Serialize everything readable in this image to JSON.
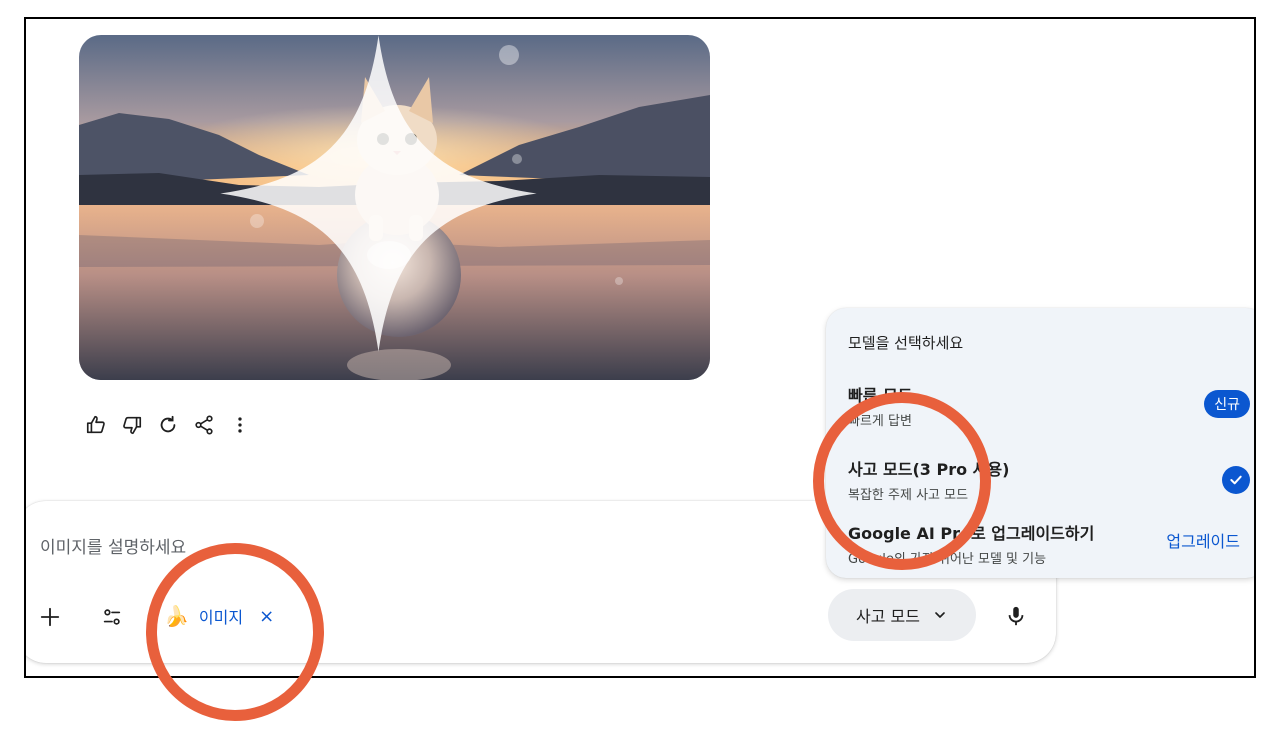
{
  "response": {
    "image_alt": "Kitten sitting on a crystal ball above a lake at sunset"
  },
  "actions": [
    {
      "name": "thumbs-up-icon"
    },
    {
      "name": "thumbs-down-icon"
    },
    {
      "name": "regenerate-icon"
    },
    {
      "name": "share-icon"
    },
    {
      "name": "more-options-icon"
    }
  ],
  "composer": {
    "placeholder": "이미지를 설명하세요",
    "chip_label": "이미지",
    "chip_close": "×",
    "mode_label": "사고 모드"
  },
  "model_menu": {
    "title": "모델을 선택하세요",
    "options": [
      {
        "name": "빠른 모드",
        "desc": "빠르게 답변",
        "badge": "신규"
      },
      {
        "name": "사고 모드(3 Pro 사용)",
        "desc": "복잡한 주제 사고 모드"
      },
      {
        "name": "Google AI Pro로 업그레이드하기",
        "desc": "Google의 가장 뛰어난 모델 및 기능",
        "action": "업그레이드"
      }
    ]
  },
  "colors": {
    "accent": "#0b57d0",
    "annotation": "#e8603c",
    "menu_bg": "#f0f4f9"
  }
}
